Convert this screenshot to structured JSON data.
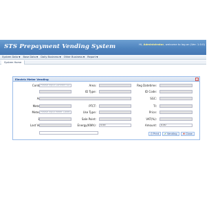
{
  "header": {
    "title": "STS Prepayment Vending System",
    "welcome_prefix": "Hi, ",
    "user": "Administrator",
    "welcome_suffix": ", welcome to log on (Ver: 1.0.0)"
  },
  "menu": [
    {
      "label": "System Data"
    },
    {
      "label": "Base Data"
    },
    {
      "label": "Daily Business"
    },
    {
      "label": "Other Business"
    },
    {
      "label": "Report"
    }
  ],
  "tab": {
    "label": "System Home"
  },
  "panel": {
    "title": "Electric Meter Vending",
    "close_symbol": "×",
    "labels": {
      "contract_id": "Contract ID:",
      "area": "Area:",
      "reg_datetime": "Reg Datetime:",
      "name": "Name:",
      "id_type": "ID Type:",
      "id_code": "ID Code:",
      "address": "Address:",
      "sgc": "SGC:",
      "meter_type": "Meter Type:",
      "ptct": "PTCT:",
      "ti": "TI:",
      "meter_code": "Meter Code:",
      "use_type": "Use Type:",
      "price": "Price:",
      "branch": "Branch:",
      "sale_point": "Sale Point:",
      "vat": "VAT(%):",
      "last_vending": "Last Vending:",
      "energy": "Energy(KWh):",
      "amount": "Amount:",
      "token": "Token:"
    },
    "placeholders": {
      "contract_id": "Please input Contract ID",
      "meter_code": "Please input Meter Code"
    },
    "values": {
      "energy": "0.00",
      "amount": "0.00"
    },
    "buttons": {
      "print": "Print",
      "vending": "Vending",
      "close": "Close"
    }
  },
  "icons": {
    "search": "magnifier-icon",
    "print": "printer-icon",
    "vending": "check-icon",
    "close": "close-icon"
  },
  "colors": {
    "header": "#4f84bf",
    "panel_border": "#99bbe8",
    "panel_title": "#15428b",
    "disabled_field": "#e2e2e2",
    "username": "#fff49a"
  }
}
